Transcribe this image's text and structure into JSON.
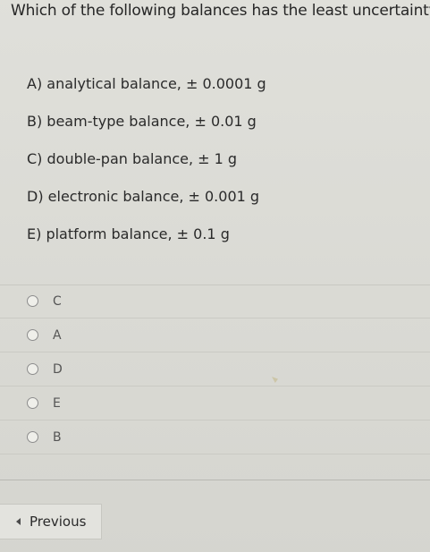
{
  "question": {
    "text": "Which of the following balances has the least uncertainty?"
  },
  "choices": [
    {
      "label": "A) analytical balance, ± 0.0001 g"
    },
    {
      "label": "B) beam-type balance, ± 0.01 g"
    },
    {
      "label": "C) double-pan balance, ± 1 g"
    },
    {
      "label": "D) electronic balance, ± 0.001 g"
    },
    {
      "label": "E) platform balance, ± 0.1 g"
    }
  ],
  "answers": [
    {
      "label": "C",
      "selected": false
    },
    {
      "label": "A",
      "selected": false
    },
    {
      "label": "D",
      "selected": false
    },
    {
      "label": "E",
      "selected": false
    },
    {
      "label": "B",
      "selected": false
    }
  ],
  "navigation": {
    "previous_label": "Previous",
    "previous_icon": "chevron-left-icon"
  }
}
